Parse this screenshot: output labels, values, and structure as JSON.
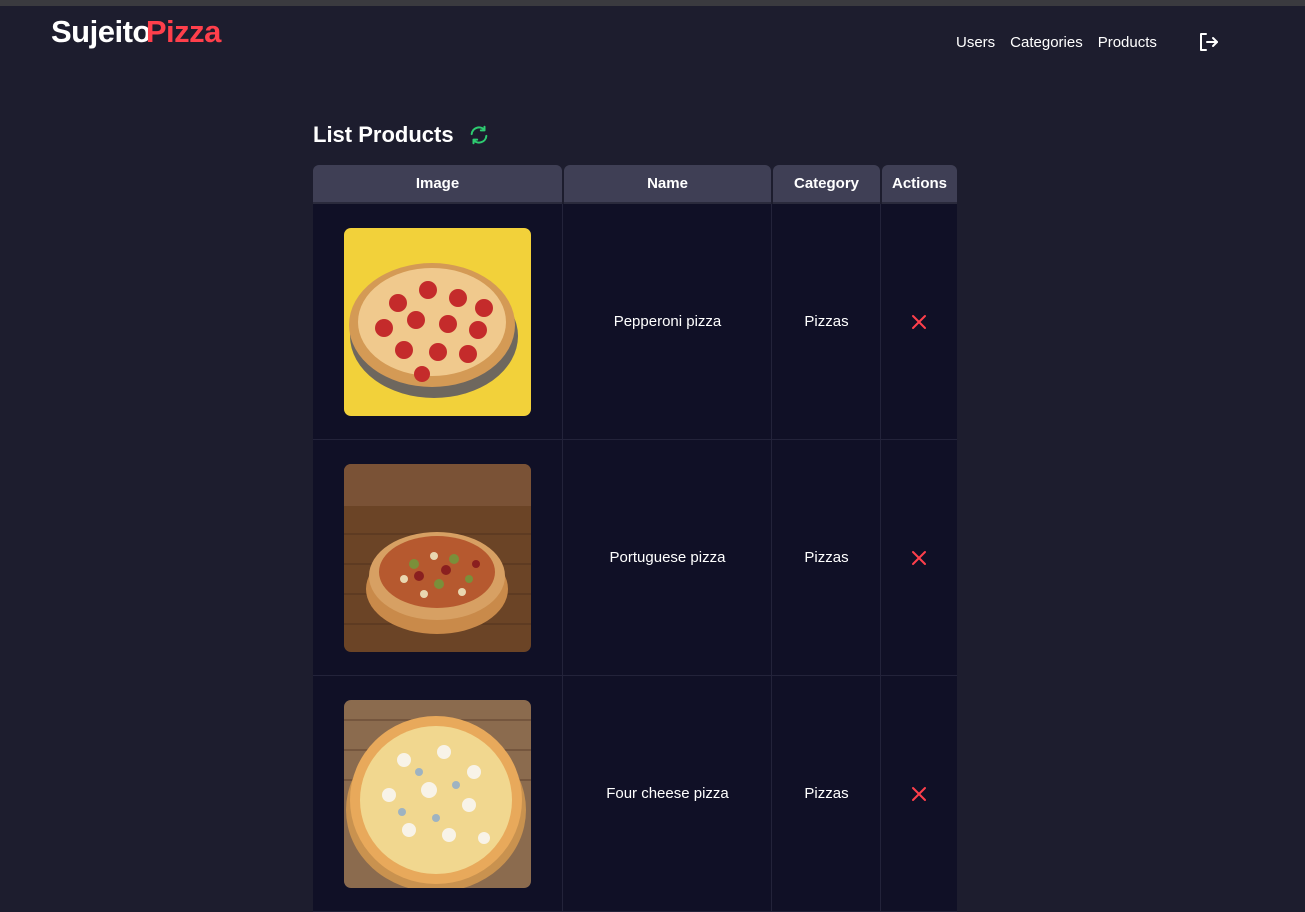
{
  "brand": {
    "part1": "Sujeito",
    "part2": "Pizza",
    "accent": "#ff3f4b"
  },
  "nav": {
    "items": [
      {
        "label": "Users"
      },
      {
        "label": "Categories"
      },
      {
        "label": "Products"
      }
    ],
    "logout_icon": "logout-icon"
  },
  "page": {
    "title": "List Products",
    "refresh_icon": "refresh-icon",
    "refresh_color": "#2ecc71"
  },
  "table": {
    "columns": [
      "Image",
      "Name",
      "Category",
      "Actions"
    ],
    "rows": [
      {
        "image": "pepperoni-pizza-photo",
        "name": "Pepperoni pizza",
        "category": "Pizzas",
        "action_icon": "delete-icon"
      },
      {
        "image": "portuguese-pizza-photo",
        "name": "Portuguese pizza",
        "category": "Pizzas",
        "action_icon": "delete-icon"
      },
      {
        "image": "four-cheese-pizza-photo",
        "name": "Four cheese pizza",
        "category": "Pizzas",
        "action_icon": "delete-icon"
      }
    ]
  }
}
